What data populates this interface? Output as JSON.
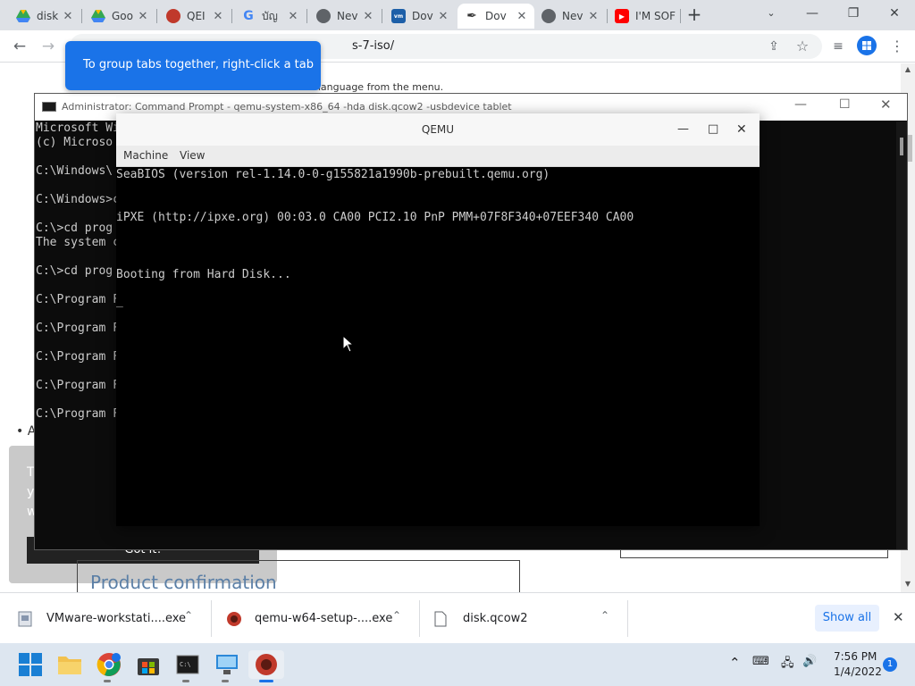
{
  "browser": {
    "tabs": [
      {
        "label": "disk",
        "icon": "google-drive-icon"
      },
      {
        "label": "Goo",
        "icon": "google-drive-icon"
      },
      {
        "label": "QEI",
        "icon": "qemu-icon"
      },
      {
        "label": "บัญ",
        "icon": "google-icon"
      },
      {
        "label": "Nev",
        "icon": "chrome-icon"
      },
      {
        "label": "Dov",
        "icon": "vmware-icon"
      },
      {
        "label": "Dov",
        "icon": "pen-icon"
      },
      {
        "label": "Nev",
        "icon": "chrome-icon"
      },
      {
        "label": "I'M SOF",
        "icon": "youtube-icon"
      }
    ],
    "url_fragment": "s-7-iso/",
    "tooltip": "To group tabs together, right-click a tab"
  },
  "webpage": {
    "text_top": "ct language from the menu.",
    "bullet": "A",
    "popup_letters": [
      "T",
      "y",
      "w"
    ],
    "popup_button": "Got it!",
    "heading": "Product confirmation"
  },
  "cmd": {
    "title": "Administrator: Command Prompt - qemu-system-x86_64 -hda disk.qcow2 -usbdevice tablet",
    "lines": [
      "Microsoft Wi",
      "(c) Microso",
      "",
      "C:\\Windows\\",
      "",
      "C:\\Windows>c",
      "",
      "C:\\>cd prog",
      "The system c",
      "",
      "C:\\>cd prog",
      "",
      "C:\\Program F",
      "",
      "C:\\Program F",
      "",
      "C:\\Program F",
      "",
      "C:\\Program F",
      "",
      "C:\\Program F"
    ]
  },
  "qemu": {
    "title": "QEMU",
    "menu": [
      "Machine",
      "View"
    ],
    "screen_lines": [
      "SeaBIOS (version rel-1.14.0-0-g155821a1990b-prebuilt.qemu.org)",
      "iPXE (http://ipxe.org) 00:03.0 CA00 PCI2.10 PnP PMM+07F8F340+07EEF340 CA00",
      "Booting from Hard Disk...",
      "_"
    ]
  },
  "downloads": {
    "items": [
      {
        "name": "VMware-workstati....exe",
        "icon": "installer-icon"
      },
      {
        "name": "qemu-w64-setup-....exe",
        "icon": "qemu-icon"
      },
      {
        "name": "disk.qcow2",
        "icon": "file-icon"
      }
    ],
    "show_all": "Show all"
  },
  "taskbar": {
    "time": "7:56 PM",
    "date": "1/4/2022",
    "notification_count": "1"
  },
  "colors": {
    "accent": "#1a73e8",
    "taskbar": "#dde6f0",
    "terminal_bg": "#0c0c0c"
  }
}
